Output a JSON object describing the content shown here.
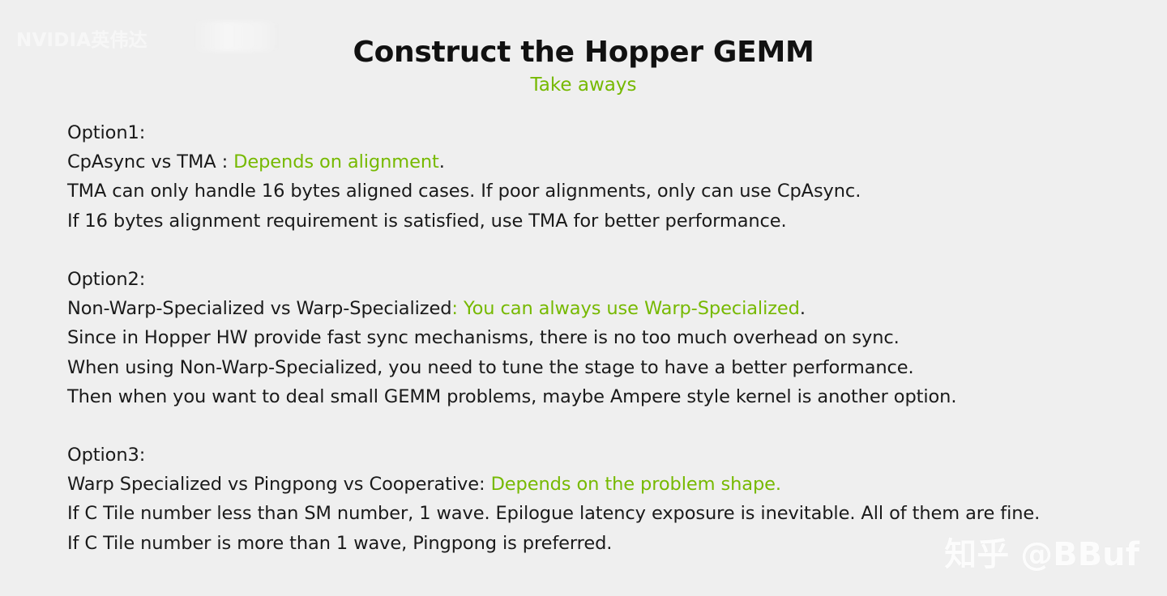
{
  "watermark_top": "NVIDIA英伟达",
  "title": "Construct the Hopper GEMM",
  "subtitle": "Take aways",
  "options": [
    {
      "heading": "Option1:",
      "lead_plain": "CpAsync vs TMA : ",
      "lead_highlight": "Depends on alignment",
      "lead_tail": ".",
      "lines": [
        "TMA can only handle 16 bytes aligned cases. If poor alignments, only can use CpAsync.",
        "If 16 bytes alignment requirement is satisfied, use TMA for better performance."
      ]
    },
    {
      "heading": "Option2:",
      "lead_plain": "Non-Warp-Specialized vs Warp-Specialized",
      "lead_highlight": ": You can always use Warp-Specialized",
      "lead_tail": ".",
      "lines": [
        "Since in Hopper HW provide fast sync mechanisms, there is no too much overhead on sync.",
        "When using Non-Warp-Specialized, you need to tune the stage to have a better performance.",
        "Then when you want to deal small GEMM problems, maybe Ampere style kernel is another option."
      ]
    },
    {
      "heading": "Option3:",
      "lead_plain": "Warp Specialized vs Pingpong vs Cooperative: ",
      "lead_highlight": "Depends on the problem shape.",
      "lead_tail": "",
      "lines": [
        "If C Tile number less than SM number, 1 wave. Epilogue latency exposure is inevitable. All of them are fine.",
        "If C Tile number is more than 1 wave, Pingpong is preferred."
      ]
    }
  ],
  "watermark_bottom": "知乎 @BBuf",
  "colors": {
    "background": "#efefef",
    "highlight": "#76b900",
    "text": "#1a1a1a"
  }
}
